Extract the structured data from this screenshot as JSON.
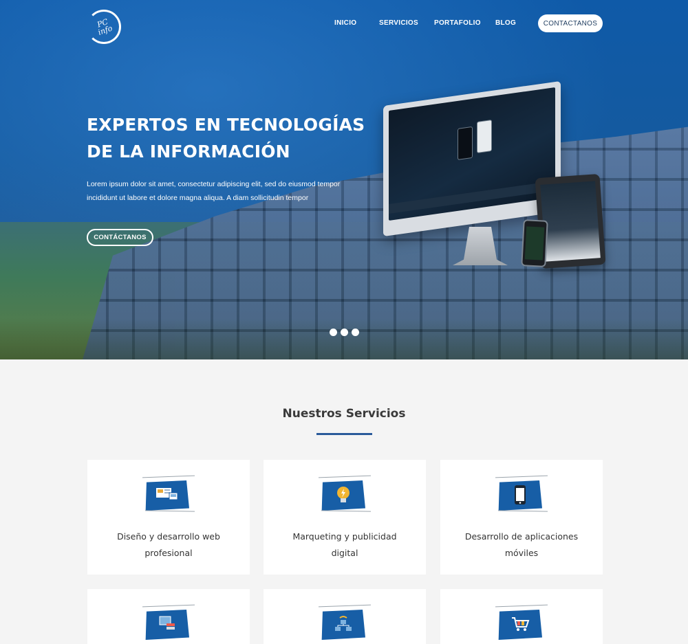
{
  "brand": {
    "logo_text": "PC\ninfo"
  },
  "nav": {
    "items": [
      {
        "label": "INICIO"
      },
      {
        "label": "SERVICIOS"
      },
      {
        "label": "PORTAFOLIO"
      },
      {
        "label": "BLOG"
      }
    ],
    "cta_label": "CONTACTANOS"
  },
  "hero": {
    "title": "EXPERTOS EN TECNOLOGÍAS DE LA INFORMACIÓN",
    "subtitle": "Lorem ipsum dolor sit amet, consectetur adipiscing elit, sed do eiusmod tempor  incididunt ut labore et dolore magna aliqua. A diam sollicitudin tempor",
    "button_label": "CONTÁCTANOS",
    "slides": 3
  },
  "services": {
    "title": "Nuestros Servicios",
    "cards": [
      {
        "label": "Diseño y desarrollo web profesional",
        "icon": "web-design-icon"
      },
      {
        "label": "Marqueting y publicidad digital",
        "icon": "lightbulb-icon"
      },
      {
        "label": "Desarrollo de aplicaciones móviles",
        "icon": "mobile-icon"
      },
      {
        "label": "",
        "icon": "database-icon"
      },
      {
        "label": "",
        "icon": "network-icon"
      },
      {
        "label": "",
        "icon": "cart-icon"
      }
    ]
  },
  "colors": {
    "primary_blue": "#175ea6",
    "accent_underline": "#2a5a9a",
    "background": "#f4f4f4"
  }
}
